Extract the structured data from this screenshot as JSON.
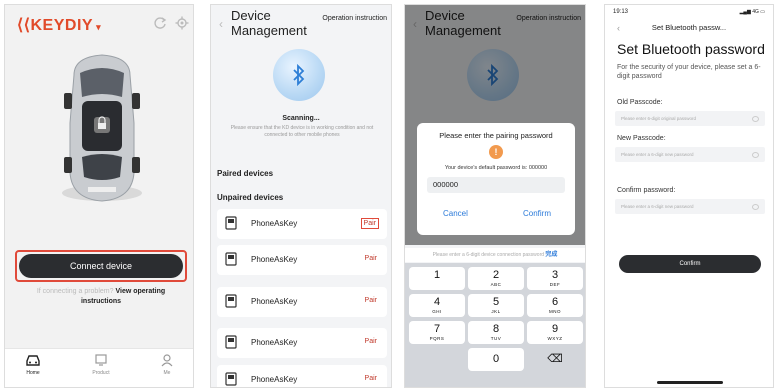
{
  "screen1": {
    "brand": "KEYDIY",
    "connect_label": "Connect device",
    "hint_faint": "If connecting a problem?",
    "hint_link": "View operating instructions",
    "tabs": [
      "Home",
      "Product",
      "Me"
    ],
    "colors": {
      "brand": "#e14a2a",
      "button": "#2b2d30",
      "highlight": "#e04a3a"
    }
  },
  "screen2": {
    "title": "Device Management",
    "operation": "Operation instruction",
    "scanning": "Scanning...",
    "scan_desc": "Please ensure that the KD device is in working condition and not connected to other mobile phones",
    "paired_header": "Paired devices",
    "unpaired_header": "Unpaired devices",
    "devices": [
      {
        "name": "PhoneAsKey",
        "action": "Pair"
      },
      {
        "name": "PhoneAsKey",
        "action": "Pair"
      },
      {
        "name": "PhoneAsKey",
        "action": "Pair"
      },
      {
        "name": "PhoneAsKey",
        "action": "Pair"
      },
      {
        "name": "PhoneAsKey",
        "action": "Pair"
      }
    ]
  },
  "screen3": {
    "title": "Device Management",
    "operation": "Operation instruction",
    "dialog": {
      "title": "Please enter the pairing password",
      "warning_icon": "!",
      "desc": "Your device's default password is: 000000",
      "value": "000000",
      "cancel": "Cancel",
      "confirm": "Confirm"
    },
    "keyboard_hint": "Please enter a 6-digit device connection password",
    "keyboard_done": "完成",
    "keys": [
      {
        "n": "1",
        "l": ""
      },
      {
        "n": "2",
        "l": "ABC"
      },
      {
        "n": "3",
        "l": "DEF"
      },
      {
        "n": "4",
        "l": "GHI"
      },
      {
        "n": "5",
        "l": "JKL"
      },
      {
        "n": "6",
        "l": "MNO"
      },
      {
        "n": "7",
        "l": "PQRS"
      },
      {
        "n": "8",
        "l": "TUV"
      },
      {
        "n": "9",
        "l": "WXYZ"
      },
      {
        "n": "",
        "l": ""
      },
      {
        "n": "0",
        "l": ""
      },
      {
        "n": "⌫",
        "l": ""
      }
    ]
  },
  "screen4": {
    "time": "19:13",
    "signal": "4G",
    "nav_title": "Set Bluetooth passw...",
    "title": "Set Bluetooth password",
    "desc": "For the security of your device, please set a 6-digit password",
    "old_label": "Old Passcode:",
    "old_placeholder": "Please enter 6-digit original password",
    "new_label": "New Passcode:",
    "new_placeholder": "Please enter a 6-digit new password",
    "confirm_label": "Confirm password:",
    "confirm_placeholder": "Please enter a 6-digit new password",
    "confirm_button": "Confirm"
  }
}
